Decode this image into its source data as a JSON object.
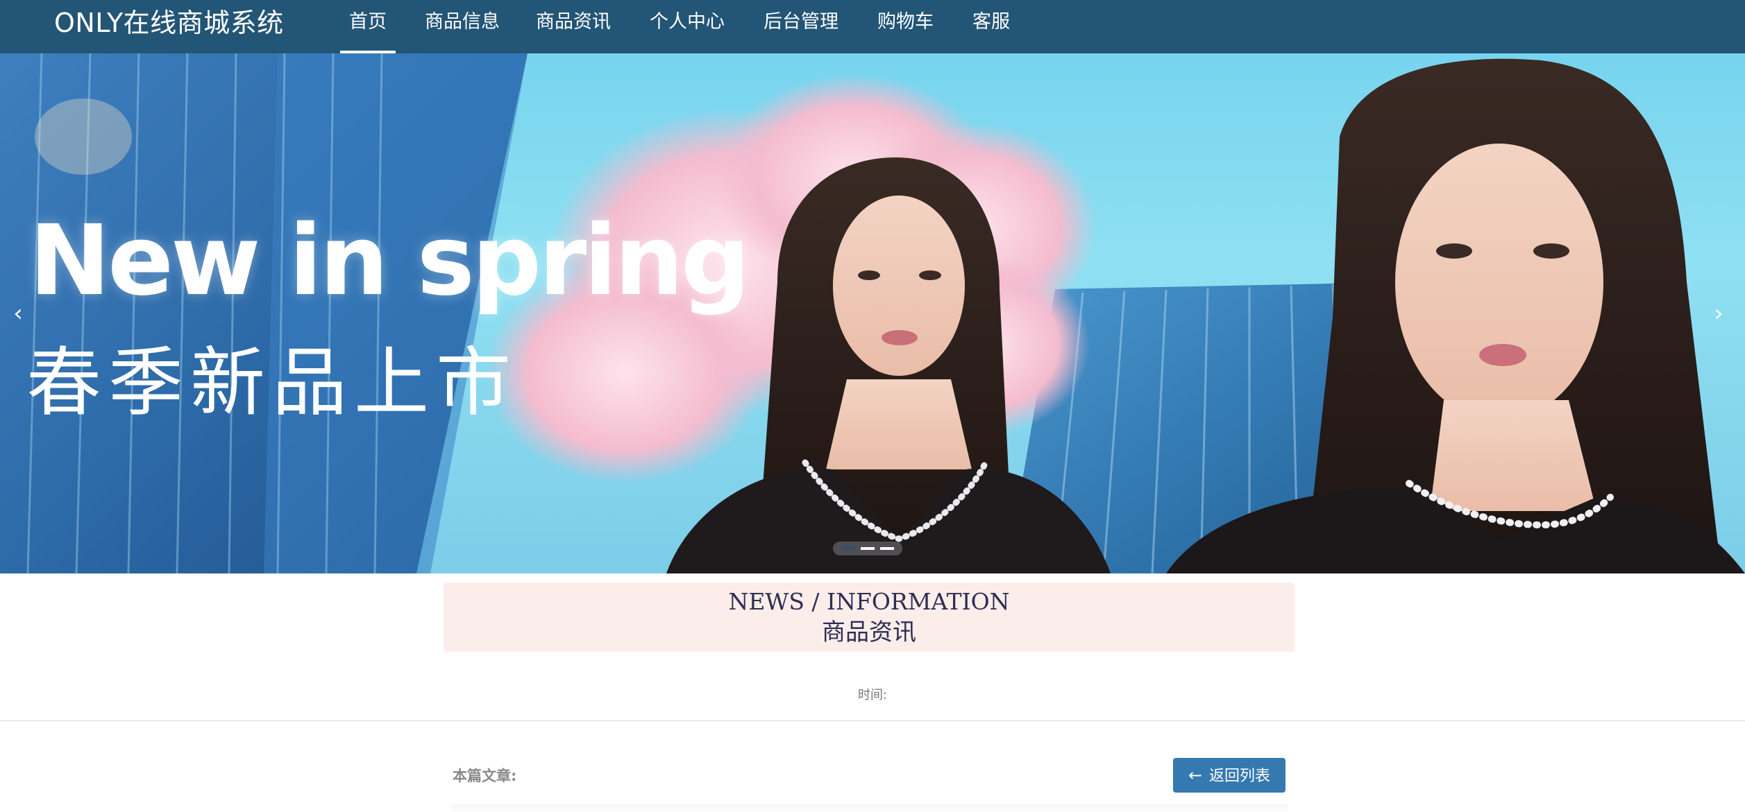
{
  "header": {
    "brand": "ONLY在线商城系统",
    "nav": [
      {
        "label": "首页",
        "active": true
      },
      {
        "label": "商品信息",
        "active": false
      },
      {
        "label": "商品资讯",
        "active": false
      },
      {
        "label": "个人中心",
        "active": false
      },
      {
        "label": "后台管理",
        "active": false
      },
      {
        "label": "购物车",
        "active": false
      },
      {
        "label": "客服",
        "active": false
      }
    ]
  },
  "banner": {
    "title_en": "New in spring",
    "title_zh": "春季新品上市",
    "prev_icon": "‹",
    "next_icon": "›",
    "slide_count": 3,
    "active_slide": 1
  },
  "news": {
    "title_en": "NEWS / INFORMATION",
    "title_zh": "商品资讯",
    "time_label": "时间:"
  },
  "article": {
    "label": "本篇文章:",
    "back_button": "返回列表",
    "back_icon": "←"
  },
  "colors": {
    "nav_bg": "#235576",
    "news_bg": "#fbeeea",
    "button_bg": "#3479b0"
  }
}
